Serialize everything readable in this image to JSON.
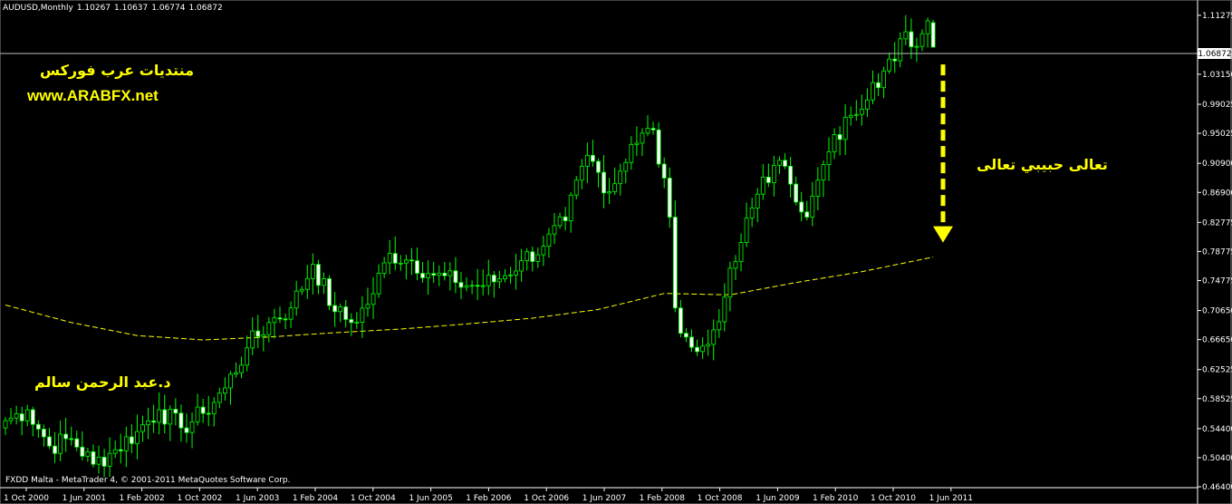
{
  "header": {
    "symbol": "AUDUSD,Monthly",
    "open": "1.10267",
    "high": "1.10637",
    "low": "1.06774",
    "close": "1.06872"
  },
  "annotations": {
    "forum_name": "منتديات عرب فوركس",
    "website": "www.ARABFX.net",
    "author": "د.عبد الرحمن سالم",
    "callout": "تعالى حبيبي تعالى"
  },
  "footer": {
    "copyright": "FXDD Malta - MetaTrader 4, © 2001-2011 MetaQuotes Software Corp."
  },
  "colors": {
    "background": "#000000",
    "candle_up_body": "#000000",
    "candle_down_body": "#ffffff",
    "candle_wick": "#00ff00",
    "moving_average": "#ffff00",
    "arrow": "#ffff00",
    "text_annotations": "#ffff00",
    "axis": "#ffffff",
    "current_price_line": "#c0c0c0"
  },
  "chart_data": {
    "type": "candlestick",
    "symbol": "AUDUSD",
    "timeframe": "Monthly",
    "y_ticks": [
      "1.11275",
      "1.03150",
      "0.99025",
      "0.95025",
      "0.90900",
      "0.86900",
      "0.82775",
      "0.78775",
      "0.74775",
      "0.70650",
      "0.66650",
      "0.62525",
      "0.58525",
      "0.54400",
      "0.50400",
      "0.46400"
    ],
    "y_range": [
      0.464,
      1.12
    ],
    "current_price": "1.06872",
    "x_tick_labels": [
      "1 Oct 2000",
      "1 Jun 2001",
      "1 Feb 2002",
      "1 Oct 2002",
      "1 Jun 2003",
      "1 Feb 2004",
      "1 Oct 2004",
      "1 Jun 2005",
      "1 Feb 2006",
      "1 Oct 2006",
      "1 Jun 2007",
      "1 Feb 2008",
      "1 Oct 2008",
      "1 Jun 2009",
      "1 Feb 2010",
      "1 Oct 2010",
      "1 Jun 2011"
    ],
    "anchors": [
      {
        "m": 0,
        "c": 0.555
      },
      {
        "m": 4,
        "c": 0.57
      },
      {
        "m": 8,
        "c": 0.52
      },
      {
        "m": 12,
        "c": 0.53
      },
      {
        "m": 16,
        "c": 0.495
      },
      {
        "m": 20,
        "c": 0.515
      },
      {
        "m": 24,
        "c": 0.54
      },
      {
        "m": 28,
        "c": 0.57
      },
      {
        "m": 32,
        "c": 0.545
      },
      {
        "m": 36,
        "c": 0.565
      },
      {
        "m": 40,
        "c": 0.6
      },
      {
        "m": 44,
        "c": 0.655
      },
      {
        "m": 48,
        "c": 0.69
      },
      {
        "m": 52,
        "c": 0.71
      },
      {
        "m": 56,
        "c": 0.77
      },
      {
        "m": 60,
        "c": 0.705
      },
      {
        "m": 63,
        "c": 0.69
      },
      {
        "m": 66,
        "c": 0.715
      },
      {
        "m": 70,
        "c": 0.785
      },
      {
        "m": 74,
        "c": 0.775
      },
      {
        "m": 78,
        "c": 0.755
      },
      {
        "m": 82,
        "c": 0.745
      },
      {
        "m": 86,
        "c": 0.74
      },
      {
        "m": 90,
        "c": 0.75
      },
      {
        "m": 94,
        "c": 0.775
      },
      {
        "m": 98,
        "c": 0.795
      },
      {
        "m": 102,
        "c": 0.83
      },
      {
        "m": 106,
        "c": 0.92
      },
      {
        "m": 110,
        "c": 0.87
      },
      {
        "m": 114,
        "c": 0.935
      },
      {
        "m": 118,
        "c": 0.955
      },
      {
        "m": 121,
        "c": 0.835
      },
      {
        "m": 122,
        "c": 0.71
      },
      {
        "m": 124,
        "c": 0.67
      },
      {
        "m": 126,
        "c": 0.65
      },
      {
        "m": 128,
        "c": 0.66
      },
      {
        "m": 131,
        "c": 0.725
      },
      {
        "m": 134,
        "c": 0.8
      },
      {
        "m": 138,
        "c": 0.89
      },
      {
        "m": 142,
        "c": 0.905
      },
      {
        "m": 146,
        "c": 0.835
      },
      {
        "m": 150,
        "c": 0.925
      },
      {
        "m": 154,
        "c": 0.975
      },
      {
        "m": 158,
        "c": 1.02
      },
      {
        "m": 162,
        "c": 1.05
      },
      {
        "m": 164,
        "c": 1.09
      },
      {
        "m": 166,
        "c": 1.07
      },
      {
        "m": 168,
        "c": 1.105
      },
      {
        "m": 169,
        "c": 1.069
      }
    ],
    "moving_average": [
      {
        "m": 0,
        "v": 0.714
      },
      {
        "m": 12,
        "v": 0.69
      },
      {
        "m": 24,
        "v": 0.672
      },
      {
        "m": 36,
        "v": 0.666
      },
      {
        "m": 48,
        "v": 0.67
      },
      {
        "m": 60,
        "v": 0.676
      },
      {
        "m": 72,
        "v": 0.681
      },
      {
        "m": 84,
        "v": 0.688
      },
      {
        "m": 96,
        "v": 0.696
      },
      {
        "m": 108,
        "v": 0.708
      },
      {
        "m": 120,
        "v": 0.73
      },
      {
        "m": 132,
        "v": 0.728
      },
      {
        "m": 144,
        "v": 0.745
      },
      {
        "m": 156,
        "v": 0.76
      },
      {
        "m": 169,
        "v": 0.78
      }
    ],
    "arrow": {
      "from_price": 1.045,
      "to_price": 0.8
    }
  }
}
